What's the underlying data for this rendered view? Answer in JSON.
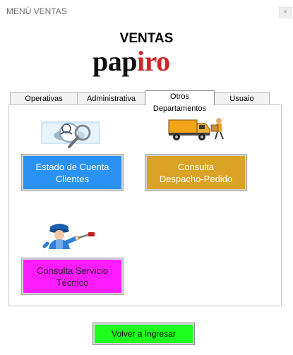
{
  "window": {
    "title": "MENÚ VENTAS",
    "close_symbol": "×"
  },
  "header": {
    "heading": "VENTAS",
    "logo_part1": "pap",
    "logo_part2": "iro"
  },
  "tabs": [
    {
      "label": "Operativas",
      "active": false
    },
    {
      "label": "Administrativa",
      "active": false
    },
    {
      "label": "Otros Departamentos",
      "active": true
    },
    {
      "label": "Usuaio",
      "active": false
    }
  ],
  "buttons": {
    "estado": "Estado de Cuenta\nClientes",
    "despacho": "Consulta\nDespacho-Pedido",
    "servicio": "Consulta Servicio\nTécnico",
    "volver": "Volver a Ingresar"
  },
  "icons": {
    "estado": "magnifier-user-icon",
    "despacho": "delivery-truck-icon",
    "servicio": "technician-icon"
  },
  "colors": {
    "estado_button": "#2a92f5",
    "despacho_button": "#daa325",
    "servicio_button": "#ff1cff",
    "volver_button": "#1eff1e",
    "logo_accent": "#d2232a"
  }
}
